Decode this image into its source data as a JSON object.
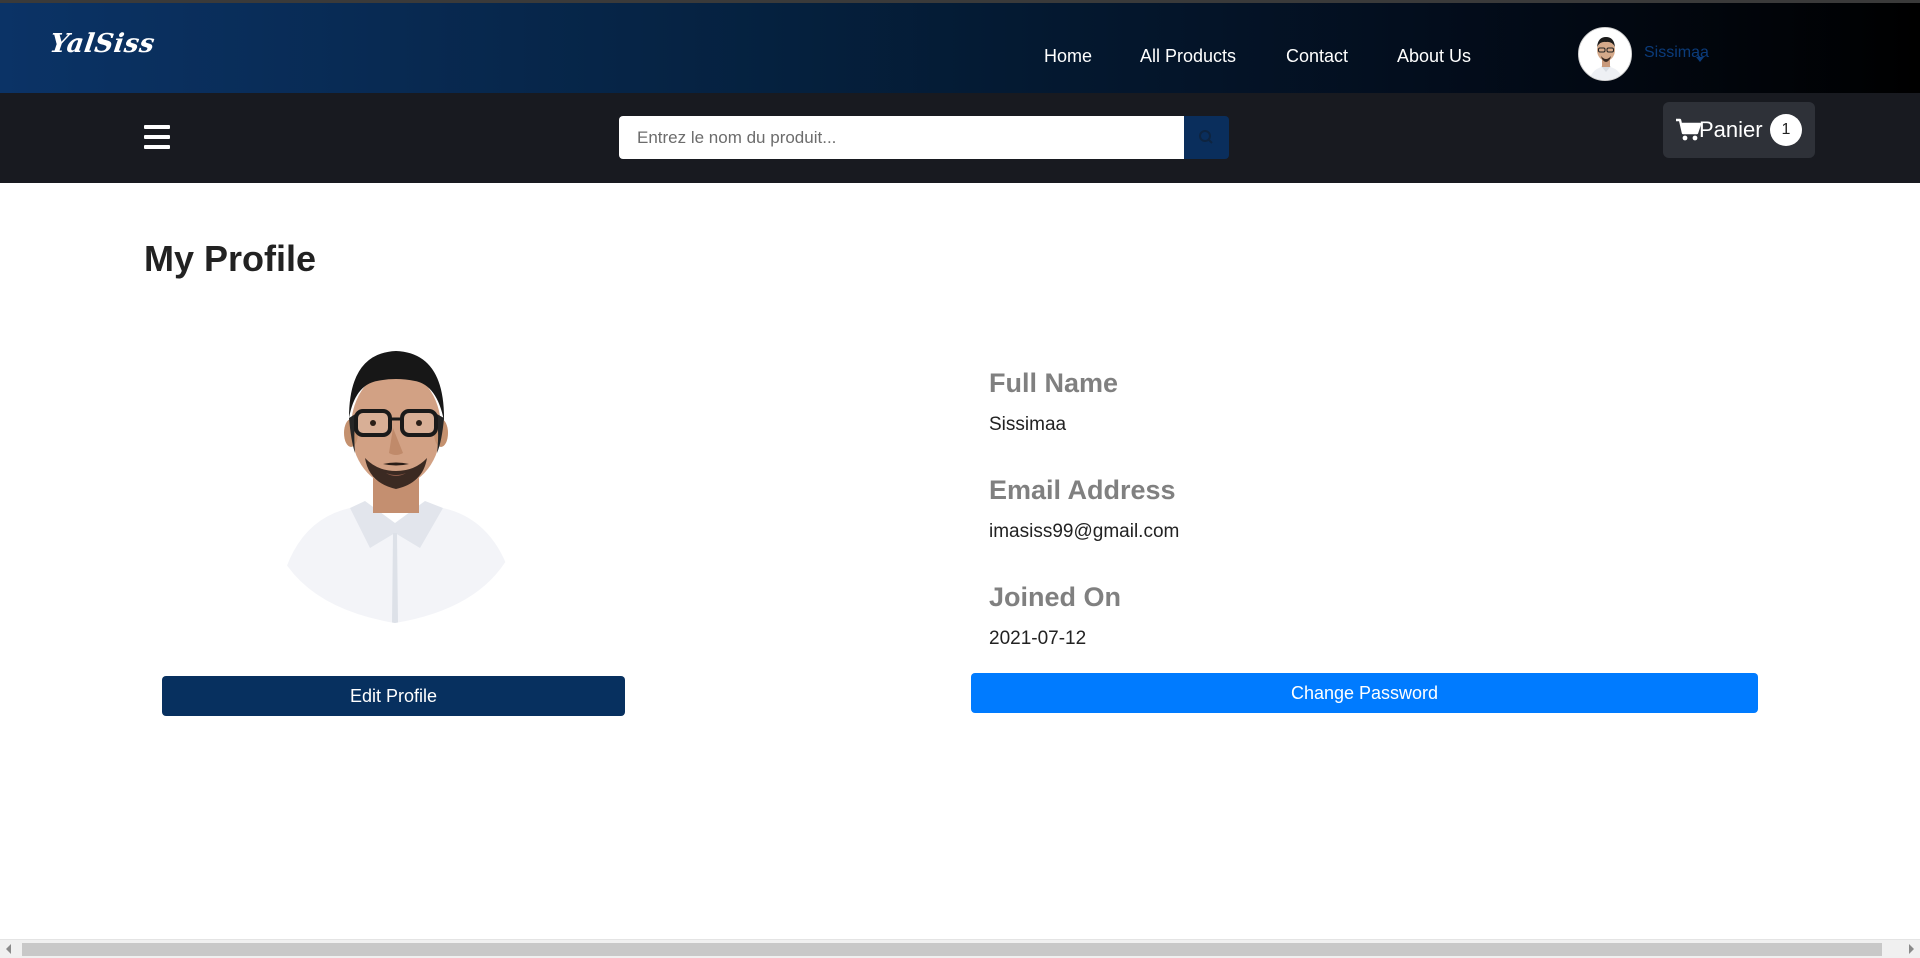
{
  "header": {
    "brand": "YalSiss",
    "nav": [
      {
        "label": "Home"
      },
      {
        "label": "All Products"
      },
      {
        "label": "Contact"
      },
      {
        "label": "About Us"
      }
    ],
    "user": {
      "name": "Sissimaa",
      "avatar_icon": "user-avatar"
    }
  },
  "toolbar": {
    "menu_icon": "hamburger-icon",
    "search": {
      "placeholder": "Entrez le nom du produit...",
      "value": "",
      "button_icon": "search-icon"
    },
    "cart": {
      "label": "Panier",
      "count": "1",
      "icon": "cart-icon"
    }
  },
  "profile": {
    "title": "My Profile",
    "photo_icon": "profile-photo",
    "edit_label": "Edit Profile",
    "fields": [
      {
        "label": "Full Name",
        "value": "Sissimaa"
      },
      {
        "label": "Email Address",
        "value": "imasiss99@gmail.com"
      },
      {
        "label": "Joined On",
        "value": "2021-07-12"
      }
    ],
    "change_password_label": "Change Password"
  },
  "colors": {
    "navbar_start": "#0b3366",
    "navbar_end": "#000000",
    "subbar": "#181a20",
    "edit_button": "#07305f",
    "password_button": "#007bff",
    "label_gray": "#808080"
  }
}
